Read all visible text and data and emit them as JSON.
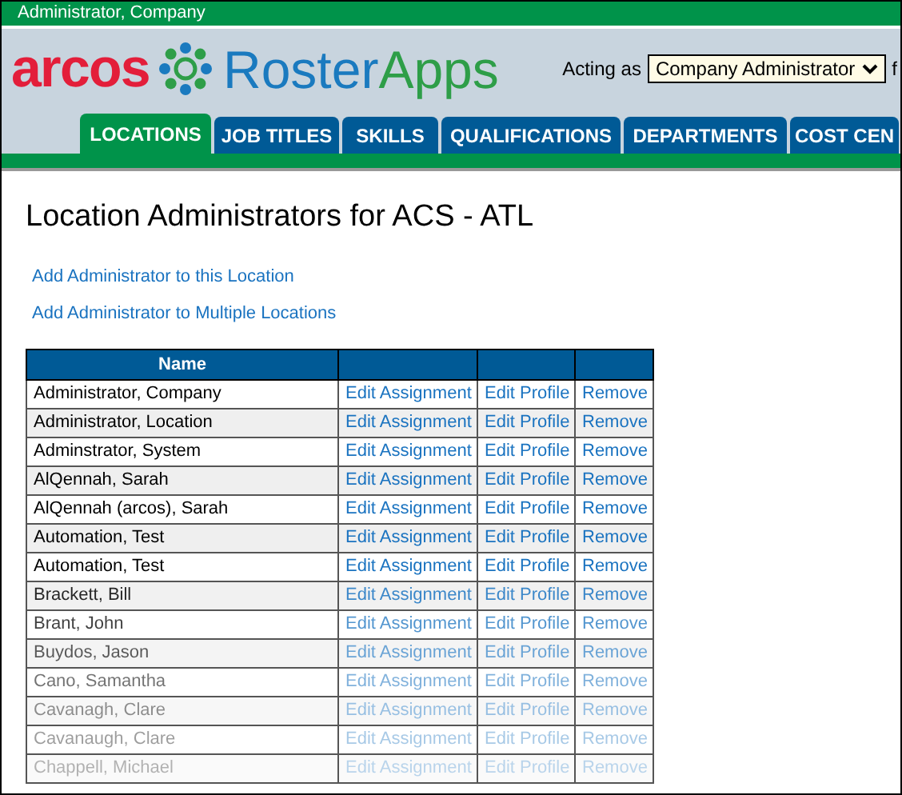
{
  "user_bar": {
    "user": "Administrator, Company"
  },
  "logo": {
    "brand": "arcos",
    "product_first": "Roster",
    "product_second": "Apps"
  },
  "acting_as": {
    "label": "Acting as",
    "value": "Company Administrator",
    "trailing": "f"
  },
  "tabs": [
    {
      "label": "LOCATIONS",
      "selected": true
    },
    {
      "label": "JOB TITLES",
      "selected": false
    },
    {
      "label": "SKILLS",
      "selected": false
    },
    {
      "label": "QUALIFICATIONS",
      "selected": false
    },
    {
      "label": "DEPARTMENTS",
      "selected": false
    },
    {
      "label": "COST CEN",
      "selected": false
    }
  ],
  "page_title": "Location Administrators for ACS - ATL",
  "links": [
    "Add Administrator to this Location",
    "Add Administrator to Multiple Locations"
  ],
  "table": {
    "columns": [
      "Name"
    ],
    "rows": [
      {
        "name": "Administrator, Company",
        "actions": [
          "Edit Assignment",
          "Edit Profile",
          "Remove"
        ]
      },
      {
        "name": "Administrator, Location",
        "actions": [
          "Edit Assignment",
          "Edit Profile",
          "Remove"
        ]
      },
      {
        "name": "Adminstrator, System",
        "actions": [
          "Edit Assignment",
          "Edit Profile",
          "Remove"
        ]
      },
      {
        "name": "AlQennah, Sarah",
        "actions": [
          "Edit Assignment",
          "Edit Profile",
          "Remove"
        ]
      },
      {
        "name": "AlQennah (arcos), Sarah",
        "actions": [
          "Edit Assignment",
          "Edit Profile",
          "Remove"
        ]
      },
      {
        "name": "Automation, Test",
        "actions": [
          "Edit Assignment",
          "Edit Profile",
          "Remove"
        ]
      },
      {
        "name": "Automation, Test",
        "actions": [
          "Edit Assignment",
          "Edit Profile",
          "Remove"
        ]
      },
      {
        "name": "Brackett, Bill",
        "actions": [
          "Edit Assignment",
          "Edit Profile",
          "Remove"
        ]
      },
      {
        "name": "Brant, John",
        "actions": [
          "Edit Assignment",
          "Edit Profile",
          "Remove"
        ]
      },
      {
        "name": "Buydos, Jason",
        "actions": [
          "Edit Assignment",
          "Edit Profile",
          "Remove"
        ]
      },
      {
        "name": "Cano, Samantha",
        "actions": [
          "Edit Assignment",
          "Edit Profile",
          "Remove"
        ]
      },
      {
        "name": "Cavanagh, Clare",
        "actions": [
          "Edit Assignment",
          "Edit Profile",
          "Remove"
        ]
      },
      {
        "name": "Cavanaugh, Clare",
        "actions": [
          "Edit Assignment",
          "Edit Profile",
          "Remove"
        ]
      },
      {
        "name": "Chappell, Michael",
        "actions": [
          "Edit Assignment",
          "Edit Profile",
          "Remove"
        ]
      }
    ]
  }
}
